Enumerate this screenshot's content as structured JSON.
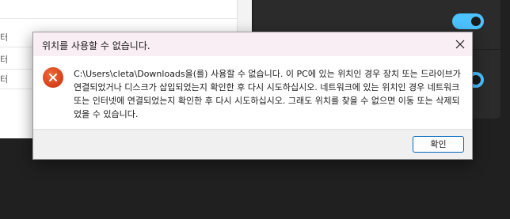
{
  "background_app": {
    "row_fragments": [
      "터",
      "터",
      "터"
    ]
  },
  "dialog": {
    "title": "위치를 사용할 수 없습니다.",
    "message": "C:\\Users\\cleta\\Downloads을(를) 사용할 수 없습니다. 이 PC에 있는 위치인 경우 장치 또는 드라이브가 연결되었거나 디스크가 삽입되었는지 확인한 후 다시 시도하십시오. 네트워크에 있는 위치인 경우 네트워크 또는 인터넷에 연결되었는지 확인한 후 다시 시도하십시오. 그래도 위치를 찾을 수 없으면 이동 또는 삭제되었을 수 있습니다.",
    "ok_label": "확인",
    "icons": {
      "error": "error-icon",
      "close": "close-icon"
    }
  },
  "colors": {
    "titlebar": "#f9eef3",
    "error_icon": "#d8401e",
    "toggle_on": "#4cc2ff",
    "button_border": "#0067c0"
  }
}
